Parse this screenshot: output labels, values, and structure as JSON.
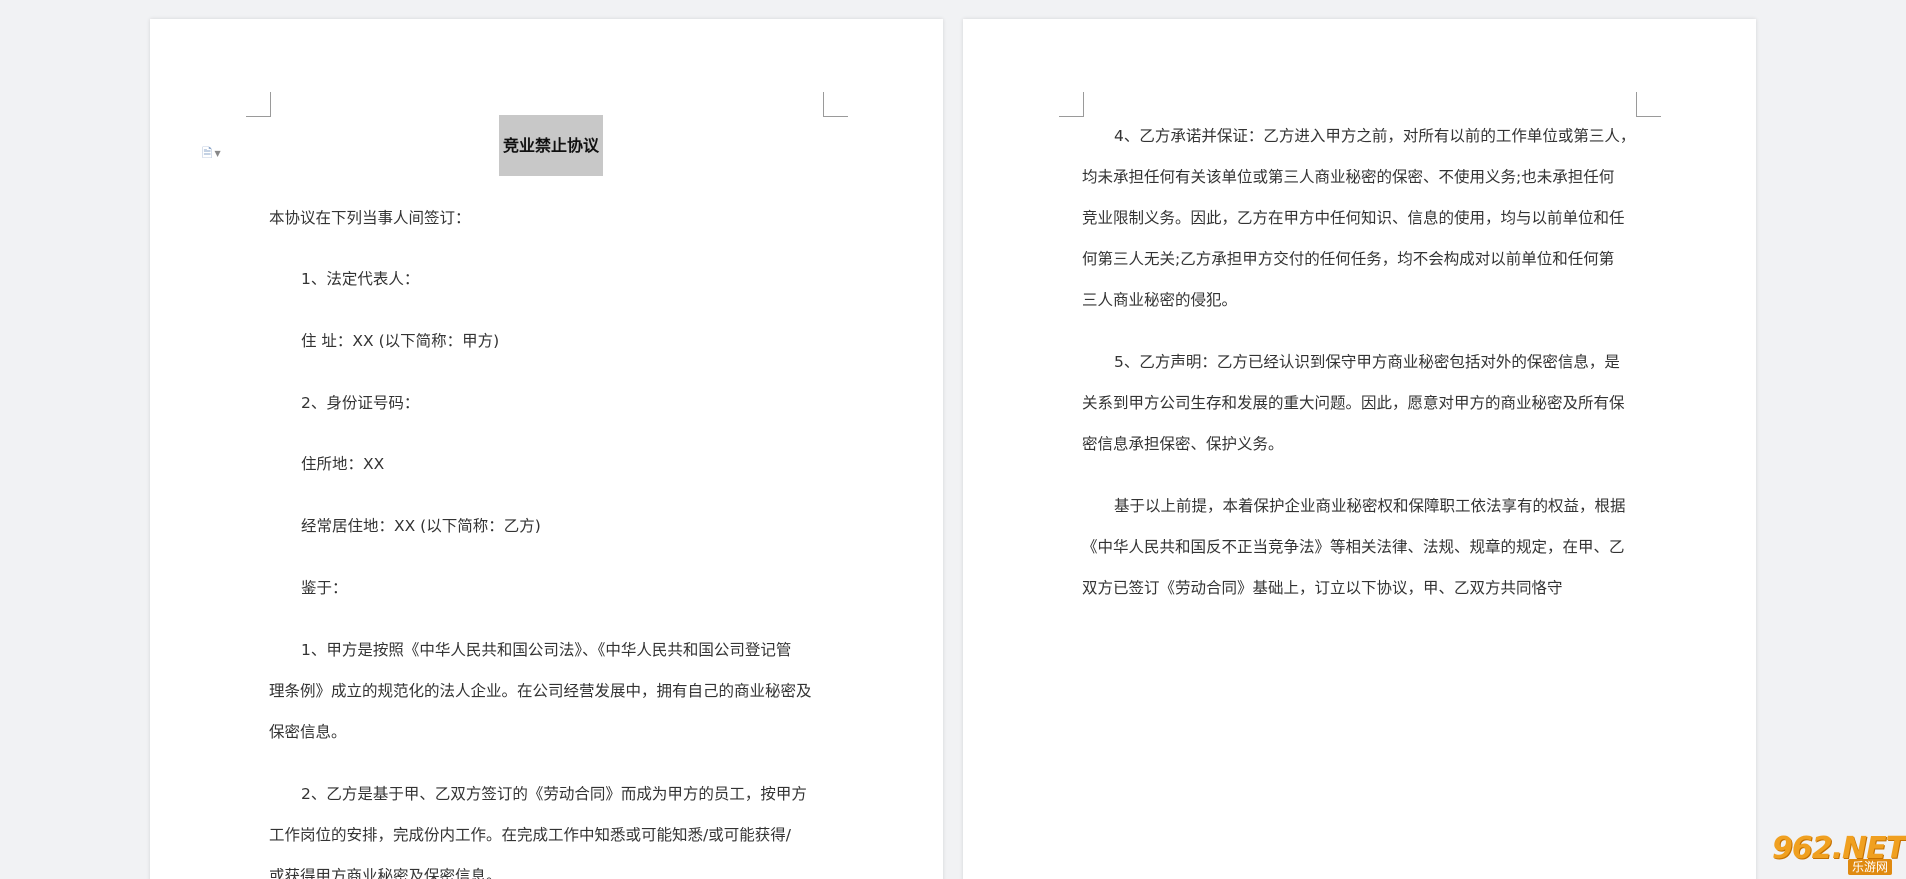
{
  "left_page": {
    "title": "竞业禁止协议",
    "lines": [
      "本协议在下列当事人间签订：",
      "1、法定代表人：",
      "住  址：XX (以下简称：甲方)",
      "2、身份证号码：",
      "住所地：XX",
      "经常居住地：XX (以下简称：乙方)",
      "鉴于：",
      "1、甲方是按照《中华人民共和国公司法》、《中华人民共和国公司登记管",
      "理条例》成立的规范化的法人企业。在公司经营发展中，拥有自己的商业秘密及",
      "保密信息。",
      "2、乙方是基于甲、乙双方签订的《劳动合同》而成为甲方的员工，按甲方",
      "工作岗位的安排，完成份内工作。在完成工作中知悉或可能知悉/或可能获得/",
      "或获得甲方商业秘密及保密信息。"
    ]
  },
  "right_page": {
    "lines": [
      "4、乙方承诺并保证：乙方进入甲方之前，对所有以前的工作单位或第三人，",
      "均未承担任何有关该单位或第三人商业秘密的保密、不使用义务;也未承担任何",
      "竞业限制义务。因此，乙方在甲方中任何知识、信息的使用，均与以前单位和任",
      "何第三人无关;乙方承担甲方交付的任何任务，均不会构成对以前单位和任何第",
      "三人商业秘密的侵犯。",
      "5、乙方声明：乙方已经认识到保守甲方商业秘密包括对外的保密信息，是",
      "关系到甲方公司生存和发展的重大问题。因此，愿意对甲方的商业秘密及所有保",
      "密信息承担保密、保护义务。",
      "基于以上前提，本着保护企业商业秘密权和保障职工依法享有的权益，根据",
      "《中华人民共和国反不正当竞争法》等相关法律、法规、规章的规定，在甲、乙",
      "双方已签订《劳动合同》基础上，订立以下协议，甲、乙双方共同恪守"
    ]
  },
  "watermark": {
    "big": "962.NET",
    "small": "乐游网"
  },
  "colors": {
    "background": "#f1f2f4",
    "page": "#ffffff",
    "title_highlight": "#c8c8c8",
    "text": "#333333",
    "watermark": "#f0a020"
  },
  "icons": {
    "doc_icon": "document-icon"
  }
}
